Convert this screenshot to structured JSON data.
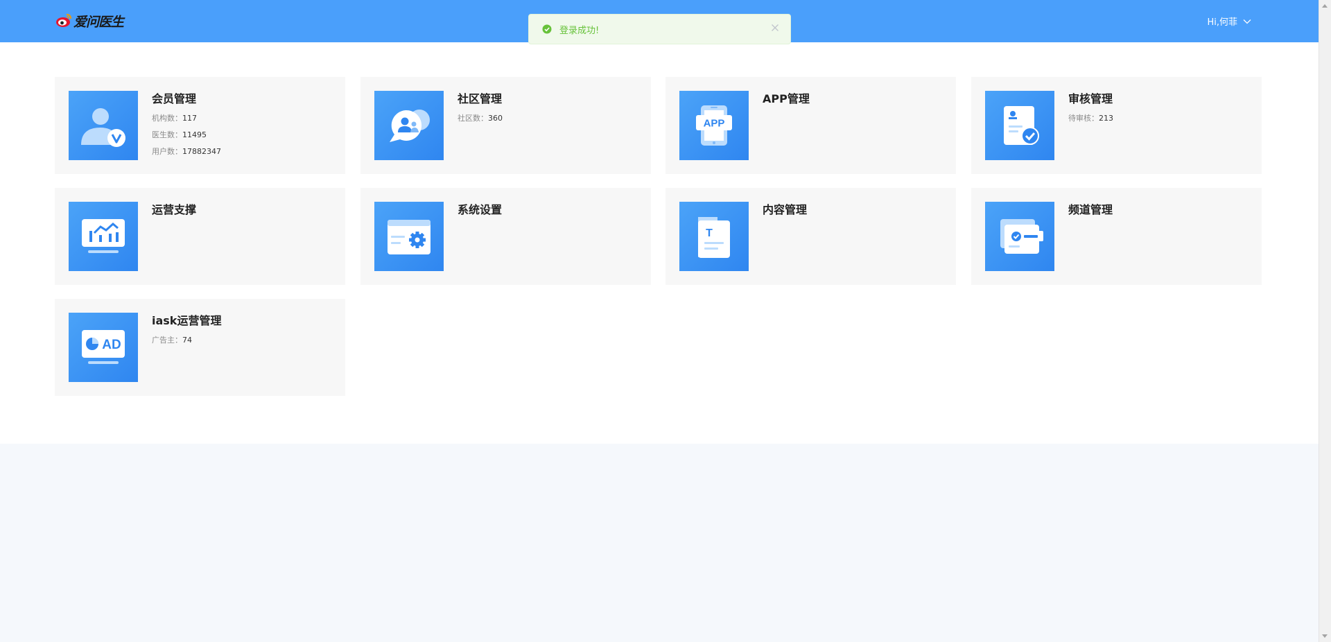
{
  "header": {
    "logo_text": "爱问医生",
    "user_greeting": "Hi,何菲",
    "bg_color": "#4a9ffb"
  },
  "toast": {
    "message": "登录成功!",
    "icon": "check-circle-icon",
    "close_icon": "close-icon",
    "color": "#67c23a"
  },
  "cards": [
    {
      "title": "会员管理",
      "icon": "member-icon",
      "stats": [
        {
          "label": "机构数：",
          "value": "117"
        },
        {
          "label": "医生数：",
          "value": "11495"
        },
        {
          "label": "用户数：",
          "value": "17882347"
        }
      ]
    },
    {
      "title": "社区管理",
      "icon": "community-chat-icon",
      "stats": [
        {
          "label": "社区数：",
          "value": "360"
        }
      ]
    },
    {
      "title": "APP管理",
      "icon": "app-phone-icon",
      "icon_text": "APP",
      "stats": []
    },
    {
      "title": "审核管理",
      "icon": "audit-document-icon",
      "stats": [
        {
          "label": "待审核：",
          "value": "213"
        }
      ]
    },
    {
      "title": "运营支撑",
      "icon": "operations-chart-icon",
      "stats": []
    },
    {
      "title": "系统设置",
      "icon": "settings-gear-icon",
      "stats": []
    },
    {
      "title": "内容管理",
      "icon": "content-document-icon",
      "icon_text": "T",
      "stats": []
    },
    {
      "title": "频道管理",
      "icon": "channel-card-icon",
      "stats": []
    },
    {
      "title": "iask运营管理",
      "icon": "ad-icon",
      "icon_text": "AD",
      "stats": [
        {
          "label": "广告主：",
          "value": "74"
        }
      ]
    }
  ]
}
